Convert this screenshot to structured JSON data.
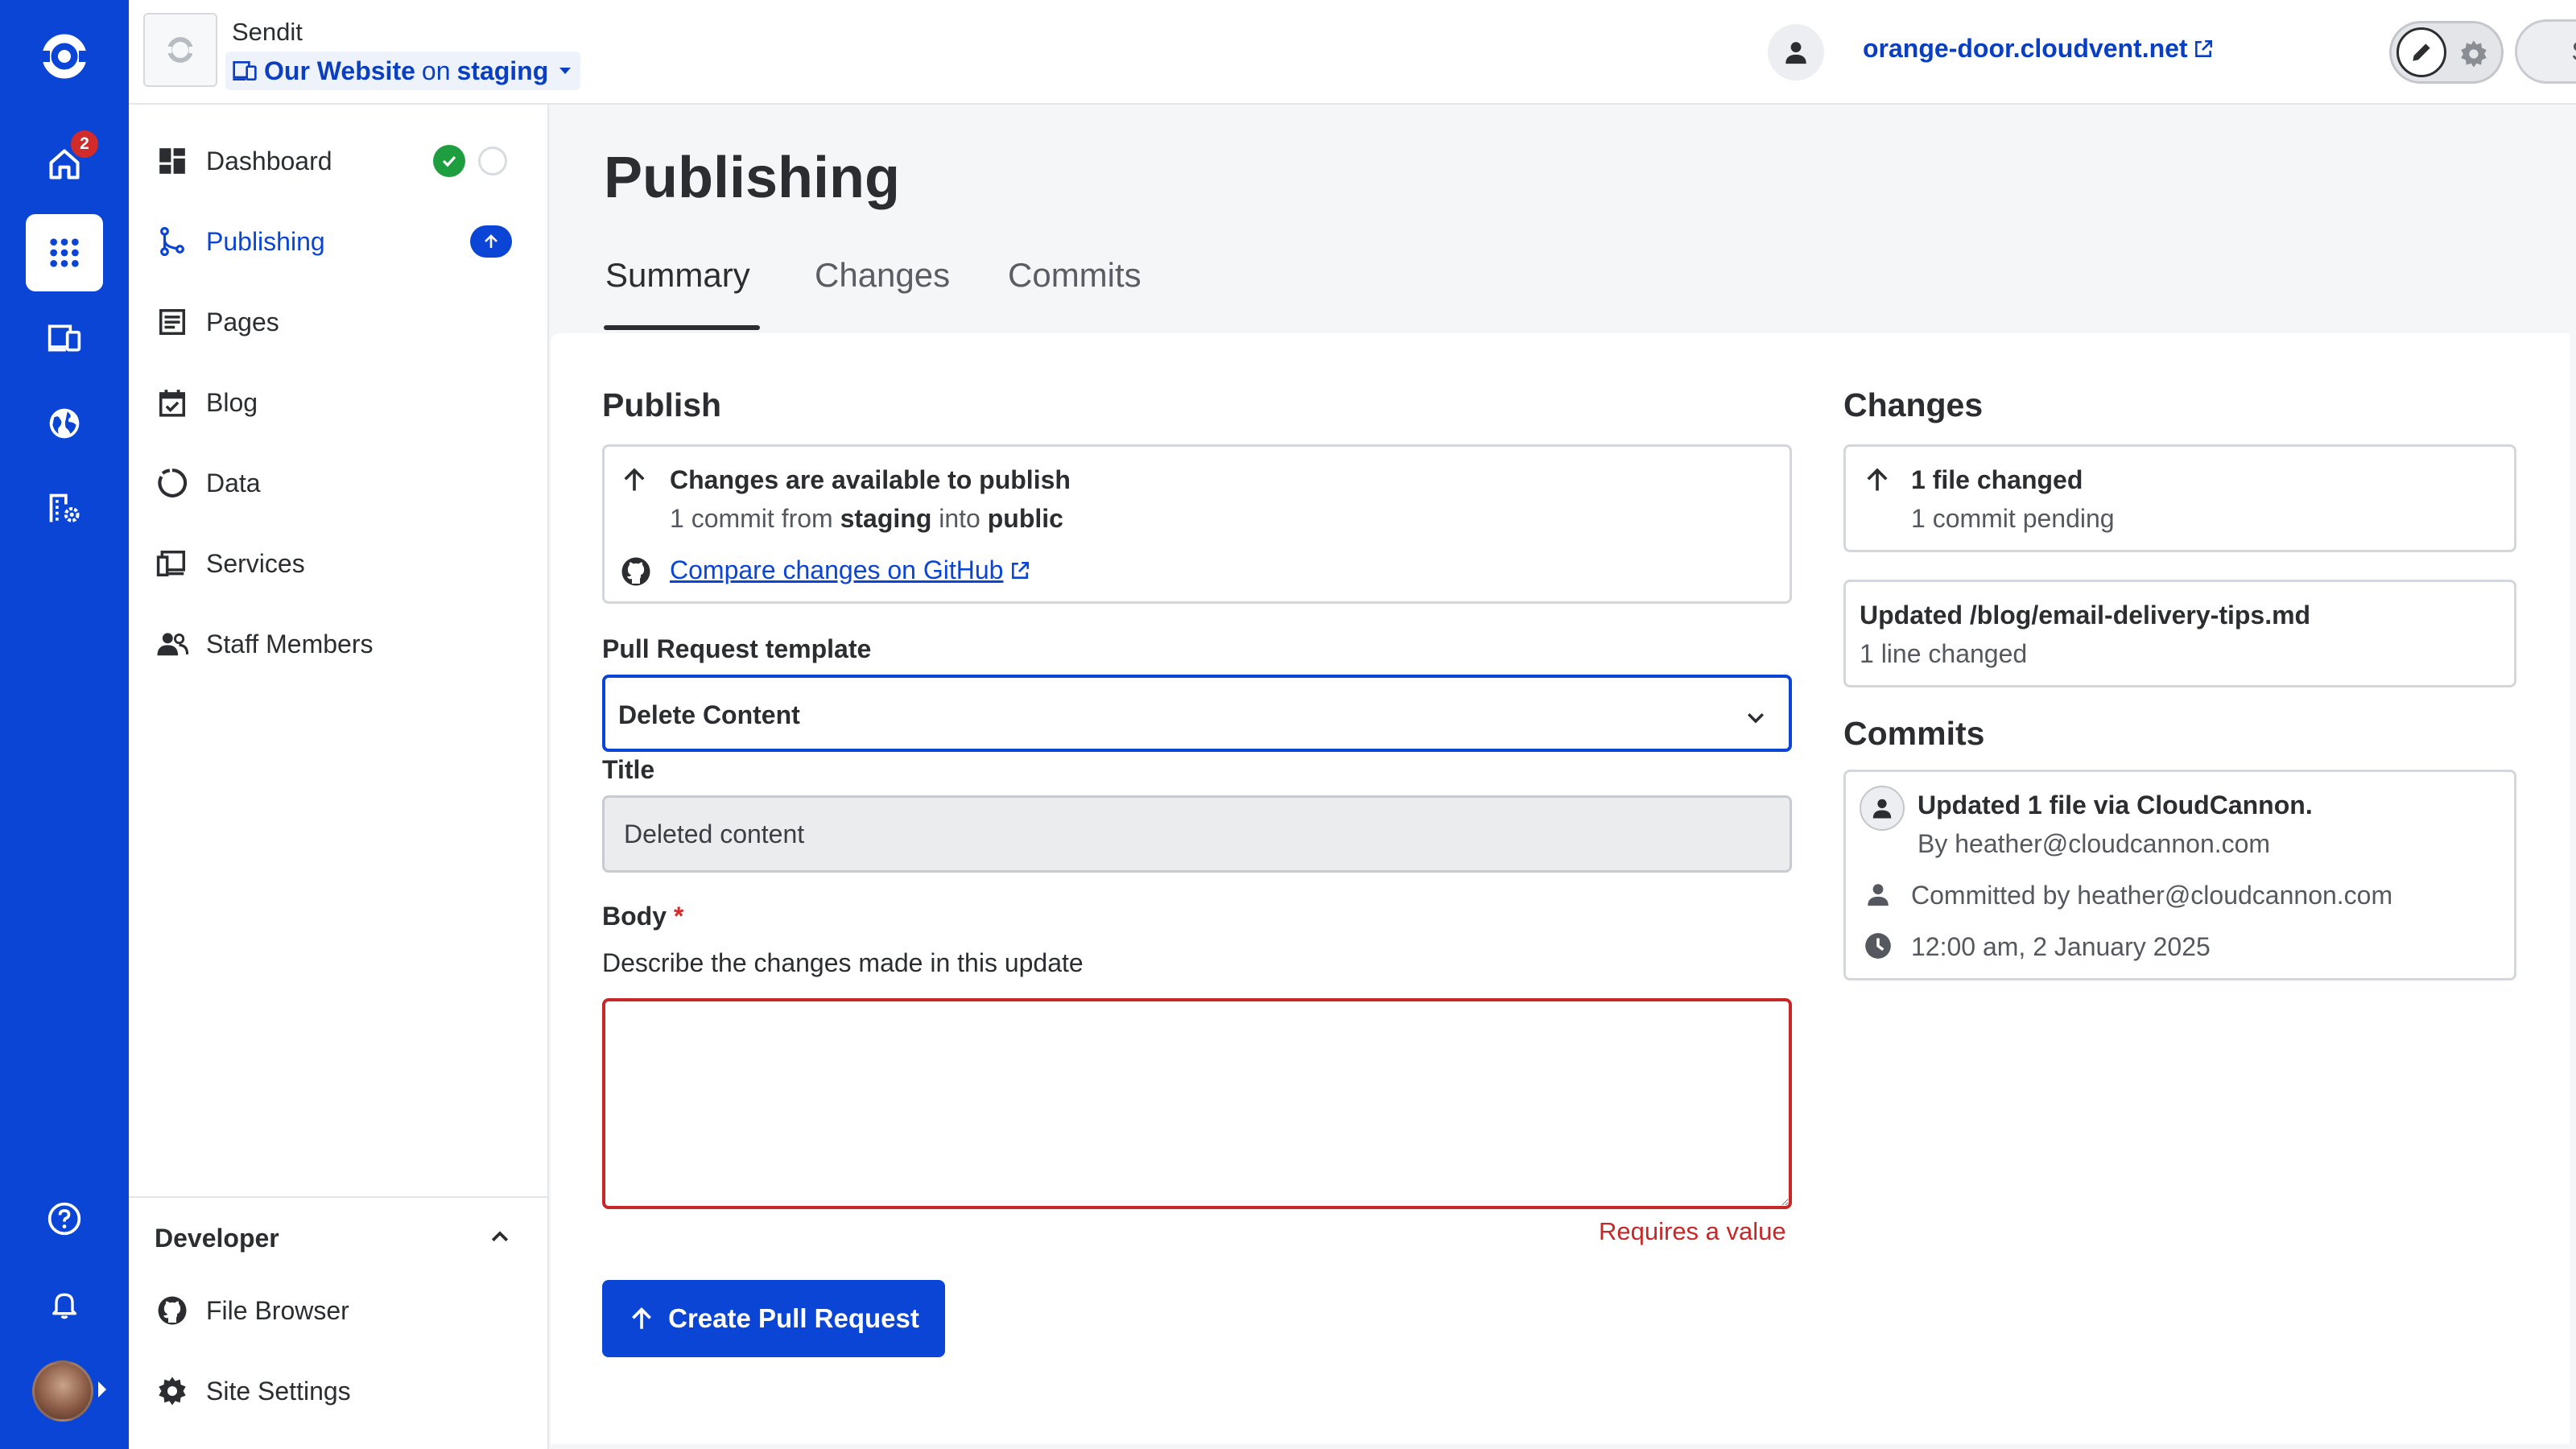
{
  "colors": {
    "brand": "#0a45d6",
    "success": "#1e9e3e",
    "error": "#c62828",
    "badge": "#d12b2b"
  },
  "rail": {
    "items": [
      {
        "name": "home",
        "icon": "home-icon",
        "badge": "2"
      },
      {
        "name": "apps",
        "icon": "apps-grid-icon",
        "active": true
      },
      {
        "name": "devices",
        "icon": "devices-icon"
      },
      {
        "name": "globe",
        "icon": "globe-icon"
      },
      {
        "name": "organization",
        "icon": "building-gear-icon"
      },
      {
        "name": "help",
        "icon": "help-icon"
      },
      {
        "name": "notifications",
        "icon": "bell-icon"
      }
    ]
  },
  "header": {
    "org_name": "Sendit",
    "site_name": "Our Website",
    "site_on": "on",
    "branch": "staging",
    "site_url": "orange-door.cloudvent.net",
    "save_label": "Save"
  },
  "sidebar": {
    "items": [
      {
        "label": "Dashboard",
        "icon": "dashboard-icon"
      },
      {
        "label": "Publishing",
        "icon": "branch-icon",
        "active": true
      },
      {
        "label": "Pages",
        "icon": "page-icon"
      },
      {
        "label": "Blog",
        "icon": "calendar-icon"
      },
      {
        "label": "Data",
        "icon": "data-icon"
      },
      {
        "label": "Services",
        "icon": "services-icon"
      },
      {
        "label": "Staff Members",
        "icon": "people-icon"
      }
    ],
    "developer": {
      "heading": "Developer",
      "items": [
        {
          "label": "File Browser",
          "icon": "github-icon"
        },
        {
          "label": "Site Settings",
          "icon": "gear-icon"
        }
      ]
    }
  },
  "main": {
    "title": "Publishing",
    "tabs": [
      {
        "label": "Summary",
        "active": true
      },
      {
        "label": "Changes"
      },
      {
        "label": "Commits"
      }
    ],
    "publish": {
      "heading": "Publish",
      "status_title": "Changes are available to publish",
      "commit_count": "1 commit from",
      "source_branch": "staging",
      "into": "into",
      "target_branch": "public",
      "compare_link": "Compare changes on GitHub"
    },
    "form": {
      "template_label": "Pull Request template",
      "template_value": "Delete Content",
      "title_label": "Title",
      "title_value": "Deleted content",
      "body_label": "Body",
      "required_star": "*",
      "body_help": "Describe the changes made in this update",
      "body_value": "",
      "error_message": "Requires a value",
      "submit_label": "Create Pull Request"
    },
    "changes": {
      "heading": "Changes",
      "files_changed": "1 file changed",
      "commits_pending": "1 commit pending",
      "file_path": "Updated /blog/email-delivery-tips.md",
      "lines_changed": "1 line changed"
    },
    "commits": {
      "heading": "Commits",
      "message": "Updated 1 file via CloudCannon.",
      "author": "By heather@cloudcannon.com",
      "committer": "Committed by heather@cloudcannon.com",
      "timestamp": "12:00 am, 2 January 2025"
    }
  }
}
